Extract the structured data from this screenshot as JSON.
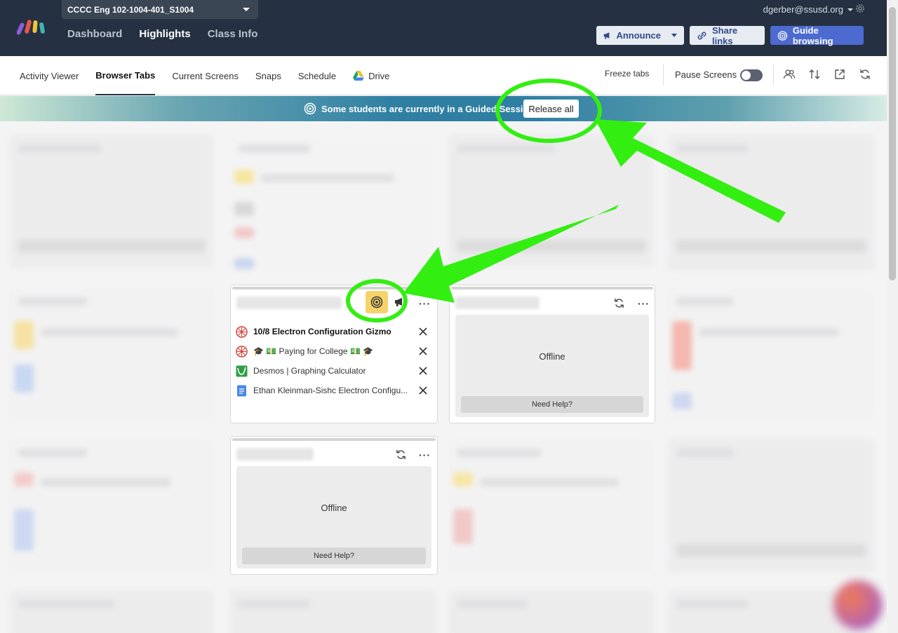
{
  "header": {
    "class_name": "CCCC Eng 102-1004-401_S1004",
    "nav": [
      "Dashboard",
      "Highlights",
      "Class Info"
    ],
    "account": "dgerber@ssusd.org",
    "announce": "Announce",
    "share": "Share links",
    "guide": "Guide browsing"
  },
  "subnav": {
    "tabs": [
      "Activity Viewer",
      "Browser Tabs",
      "Current Screens",
      "Snaps",
      "Schedule",
      "Drive"
    ],
    "active_tab": "Browser Tabs",
    "freeze": "Freeze tabs",
    "pause": "Pause Screens"
  },
  "banner": {
    "message": "Some students are currently in a Guided Session",
    "release": "Release all"
  },
  "student_card": {
    "tabs": [
      {
        "title": "10/8 Electron Configuration Gizmo",
        "icon": "explorelearning-icon",
        "bold": true
      },
      {
        "title": "🎓 💵 Paying for College 💵 🎓",
        "icon": "explorelearning-icon",
        "bold": false
      },
      {
        "title": "Desmos | Graphing Calculator",
        "icon": "desmos-icon",
        "bold": false
      },
      {
        "title": "Ethan Kleinman-Sishc Electron Configu...",
        "icon": "google-docs-icon",
        "bold": false
      }
    ]
  },
  "offline_cards": {
    "status": "Offline",
    "help": "Need Help?"
  },
  "colors": {
    "header_bg": "#253142",
    "accent": "#4c6ad0",
    "guided_chip": "#f6d26a",
    "annotation": "#33ee11"
  }
}
